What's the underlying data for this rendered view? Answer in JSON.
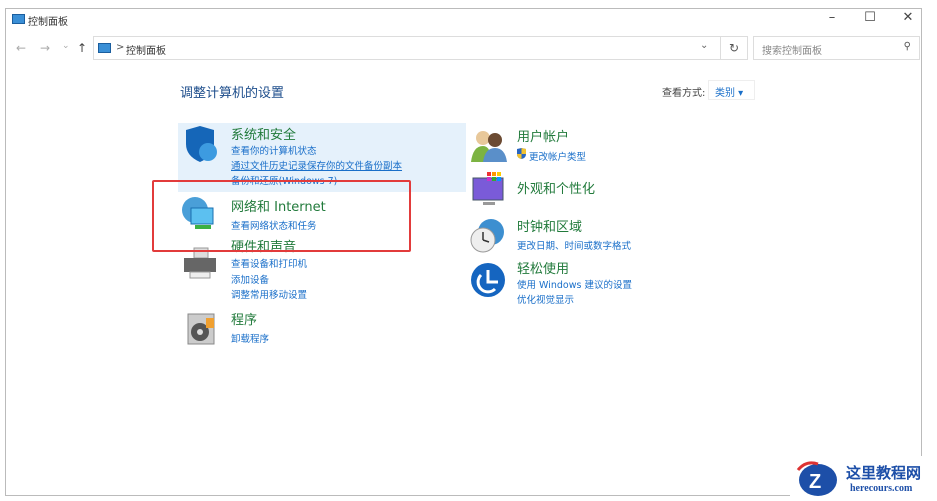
{
  "window": {
    "title": "控制面板",
    "minimize": "–",
    "maximize": "☐",
    "close": "✕"
  },
  "nav": {
    "back": "←",
    "forward": "→",
    "recent": "⌄",
    "up": "↑",
    "breadcrumb_sep": ">",
    "breadcrumb": "控制面板",
    "dropdown": "⌄",
    "refresh": "↻",
    "search_placeholder": "搜索控制面板",
    "search_icon": "⚲"
  },
  "main": {
    "heading": "调整计算机的设置",
    "view_by_label": "查看方式:",
    "view_by_value": "类别 ▾"
  },
  "categories_left": [
    {
      "title": "系统和安全",
      "links": [
        "查看你的计算机状态",
        "通过文件历史记录保存你的文件备份副本",
        "备份和还原(Windows 7)"
      ]
    },
    {
      "title": "网络和 Internet",
      "links": [
        "查看网络状态和任务"
      ]
    },
    {
      "title": "硬件和声音",
      "links": [
        "查看设备和打印机",
        "添加设备",
        "调整常用移动设置"
      ]
    },
    {
      "title": "程序",
      "links": [
        "卸载程序"
      ]
    }
  ],
  "categories_right": [
    {
      "title": "用户帐户",
      "links": [
        "更改帐户类型"
      ]
    },
    {
      "title": "外观和个性化",
      "links": []
    },
    {
      "title": "时钟和区域",
      "links": [
        "更改日期、时间或数字格式"
      ]
    },
    {
      "title": "轻松使用",
      "links": [
        "使用 Windows 建议的设置",
        "优化视觉显示"
      ]
    }
  ],
  "watermark": {
    "name": "这里教程网",
    "url": "herecours.com"
  },
  "colors": {
    "highlight": "#e5f1fb",
    "annotation": "#e23b3b",
    "link": "#1a6fc9",
    "title": "#217a3b"
  }
}
